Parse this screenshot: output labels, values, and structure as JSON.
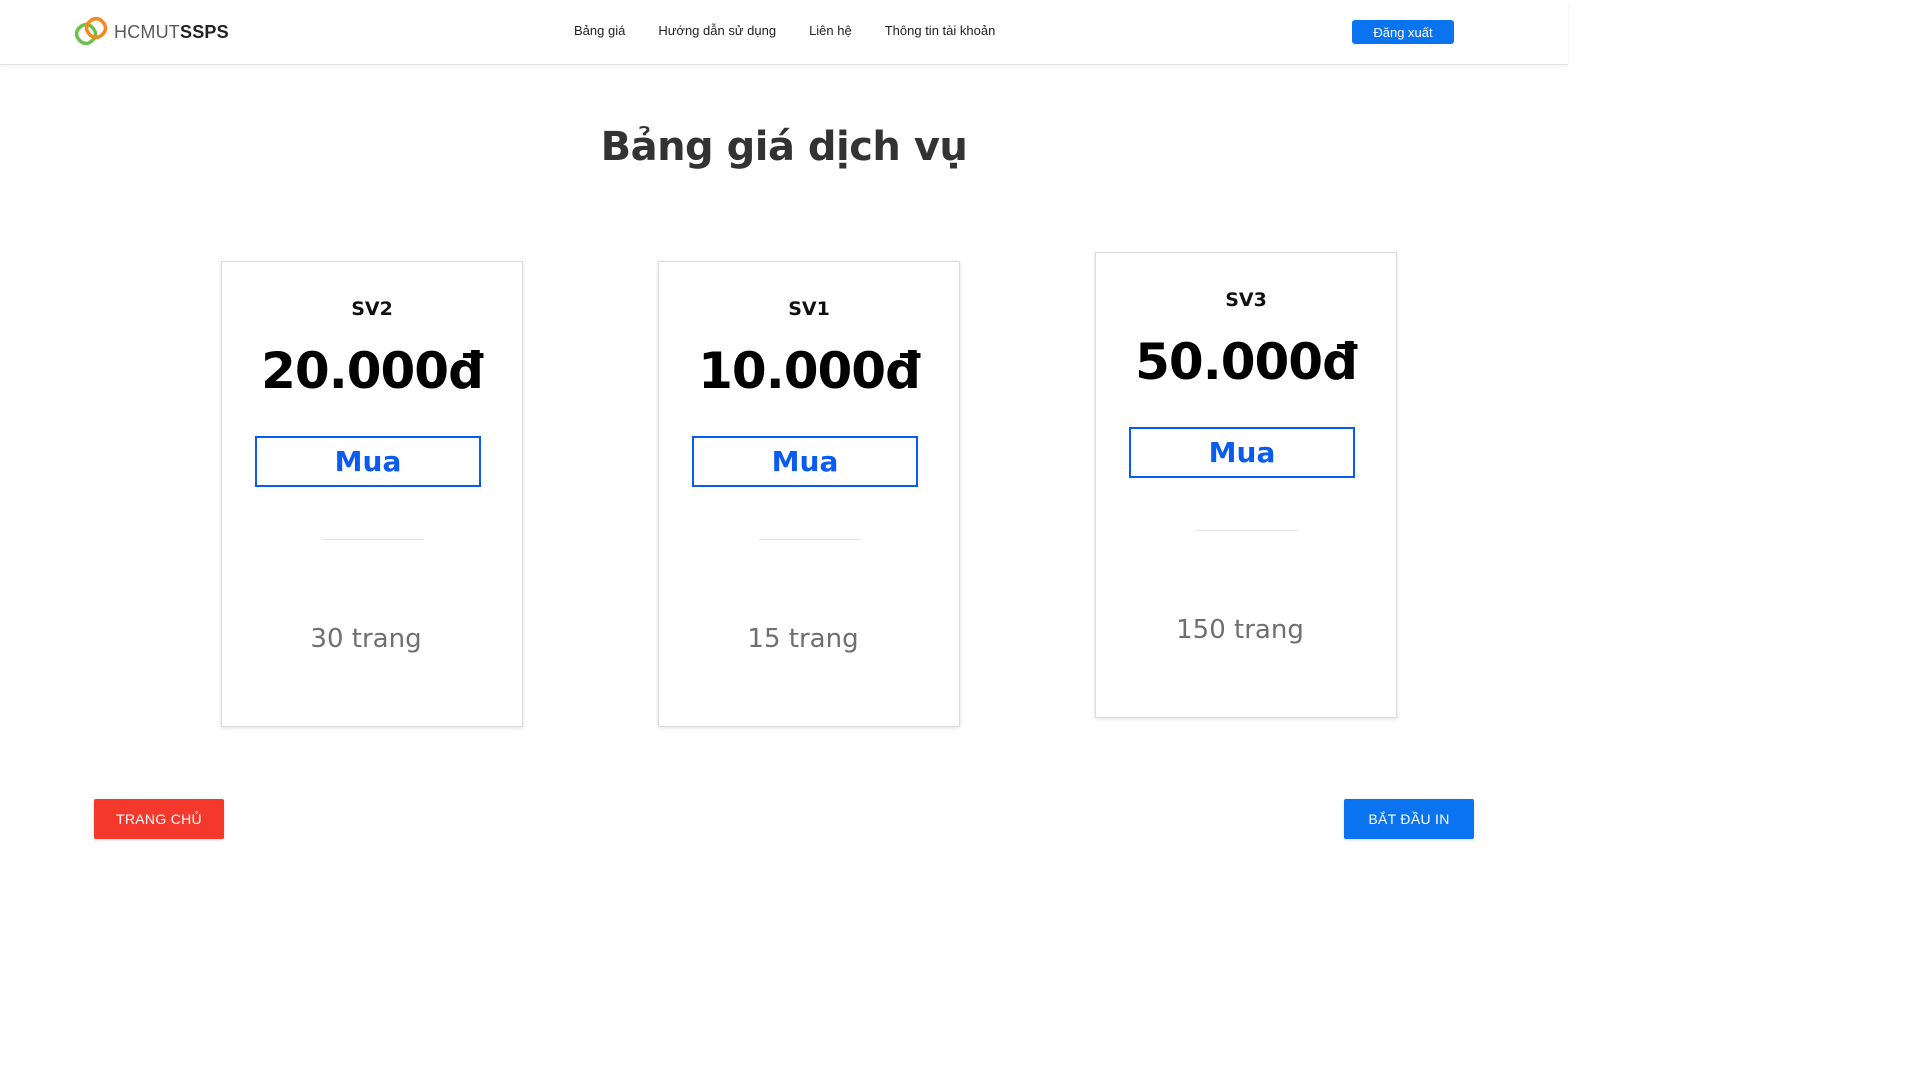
{
  "header": {
    "logo": {
      "light": "HCMUT",
      "bold": "SSPS"
    },
    "nav": [
      {
        "label": "Bảng giá"
      },
      {
        "label": "Hướng dẫn sử dụng"
      },
      {
        "label": "Liên hệ"
      },
      {
        "label": "Thông tin tài khoản"
      }
    ],
    "logout_label": "Đăng xuất"
  },
  "main": {
    "title": "Bảng giá dịch vụ",
    "plans": [
      {
        "name": "SV2",
        "price": "20.000đ",
        "buy_label": "Mua",
        "pages": "30 trang"
      },
      {
        "name": "SV1",
        "price": "10.000đ",
        "buy_label": "Mua",
        "pages": "15 trang"
      },
      {
        "name": "SV3",
        "price": "50.000đ",
        "buy_label": "Mua",
        "pages": "150 trang"
      }
    ]
  },
  "footer": {
    "home_label": "TRANG CHỦ",
    "start_label": "BẮT ĐẦU IN"
  },
  "colors": {
    "primary": "#0a74f0",
    "buy_border": "#0a5cf0",
    "danger": "#f5382c",
    "logo_orange": "#f28a1f",
    "logo_green": "#6cc04a"
  },
  "icons": {
    "logo": "linked-rings-logo-icon"
  }
}
